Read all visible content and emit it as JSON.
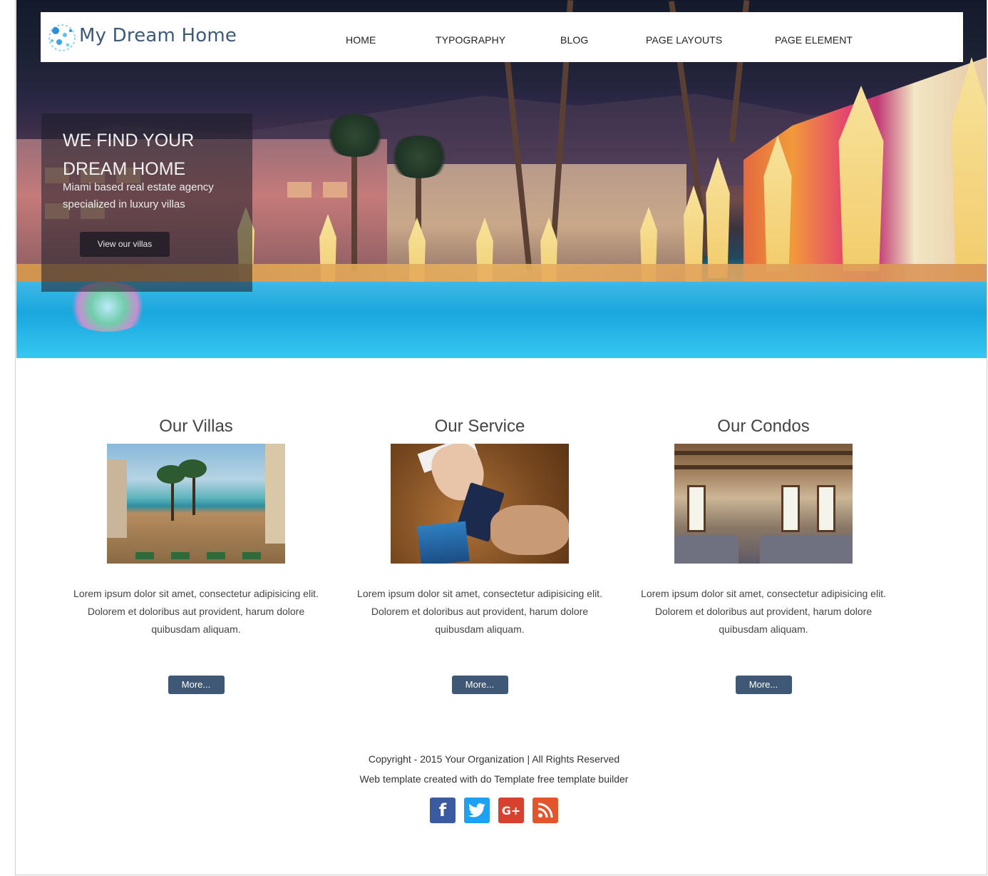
{
  "brand": {
    "name": "My Dream Home",
    "logo_icon": "bubbles-logo-icon",
    "accent": "#3c5a7a"
  },
  "nav": {
    "items": [
      {
        "label": "HOME"
      },
      {
        "label": "TYPOGRAPHY"
      },
      {
        "label": "BLOG"
      },
      {
        "label": "PAGE LAYOUTS"
      },
      {
        "label": "PAGE ELEMENT"
      }
    ]
  },
  "hero": {
    "title": "WE FIND YOUR DREAM HOME",
    "subtitle": "Miami based real estate agency specialized in luxury villas",
    "button": "View our villas"
  },
  "columns": [
    {
      "title": "Our Villas",
      "text": "Lorem ipsum dolor sit amet, consectetur adipisicing elit. Dolorem et doloribus aut provident, harum dolore quibusdam aliquam.",
      "button": "More..."
    },
    {
      "title": "Our Service",
      "text": "Lorem ipsum dolor sit amet, consectetur adipisicing elit. Dolorem et doloribus aut provident, harum dolore quibusdam aliquam.",
      "button": "More..."
    },
    {
      "title": "Our Condos",
      "text": "Lorem ipsum dolor sit amet, consectetur adipisicing elit. Dolorem et doloribus aut provident, harum dolore quibusdam aliquam.",
      "button": "More..."
    }
  ],
  "footer": {
    "copyright": "Copyright - 2015 Your Organization | All Rights Reserved",
    "credit": "Web template created with do Template free template builder",
    "social": [
      {
        "icon": "facebook-icon",
        "glyph": "f",
        "color": "#3b5ba0"
      },
      {
        "icon": "twitter-icon",
        "glyph": "t",
        "color": "#1da1f2"
      },
      {
        "icon": "google-plus-icon",
        "glyph": "G+",
        "color": "#d6422e"
      },
      {
        "icon": "rss-icon",
        "glyph": "⦿",
        "color": "#e5552c"
      }
    ]
  },
  "colors": {
    "button_bg": "#3f5876",
    "caption_bg": "rgba(30,30,40,0.55)"
  }
}
